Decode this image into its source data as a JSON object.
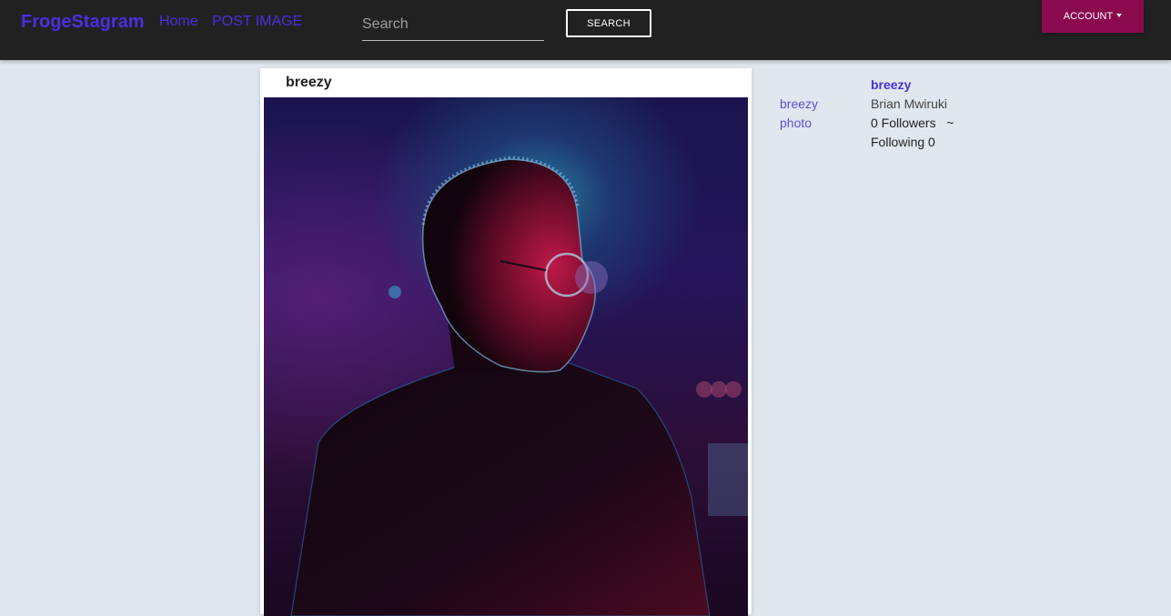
{
  "navbar": {
    "brand": "FrogeStagram",
    "links": [
      {
        "label": "Home"
      },
      {
        "label": "POST IMAGE"
      }
    ],
    "search": {
      "placeholder": "Search",
      "value": ""
    },
    "search_button": "SEARCH",
    "account_button": "ACCOUNT",
    "colors": {
      "background": "#212121",
      "brand": "#4b2fe0",
      "account": "#8b0a4e"
    }
  },
  "post": {
    "username": "breezy"
  },
  "profile": {
    "photo_alt": "breezy photo",
    "username": "breezy",
    "full_name": "Brian Mwiruki",
    "followers": "0 Followers   ~",
    "following": "Following 0"
  }
}
